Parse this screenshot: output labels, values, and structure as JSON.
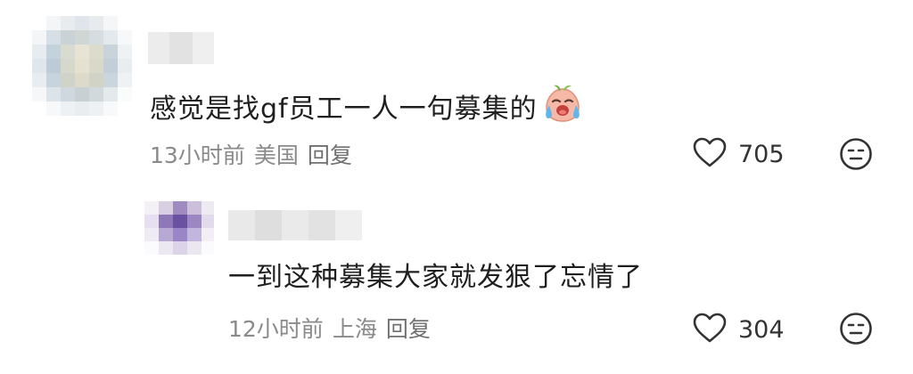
{
  "comments": [
    {
      "text": "感觉是找gf员工一人一句募集的",
      "emoji": "crying-face-emoji",
      "time": "13小时前",
      "location": "美国",
      "reply_label": "回复",
      "likes": "705"
    },
    {
      "text": "一到这种募集大家就发狠了忘情了",
      "time": "12小时前",
      "location": "上海",
      "reply_label": "回复",
      "likes": "304"
    }
  ],
  "colors": {
    "text": "#1f1f1f",
    "meta": "#8a8a8a",
    "icon": "#333333"
  }
}
